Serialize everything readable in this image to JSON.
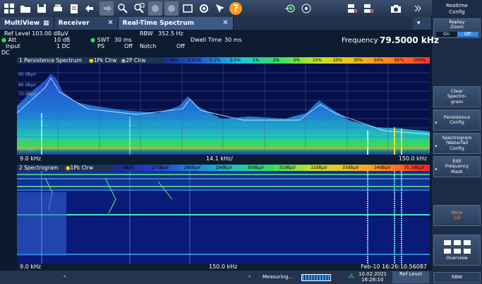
{
  "toolbar": {
    "question_icon": "?"
  },
  "sidebar": {
    "title": "Realtime\nConfig",
    "replay_zoom": "Replay\nZoom",
    "on": "On",
    "off": "Off",
    "clear": "Clear\nSpectro-\ngram",
    "persistence": "Persistence\nConfig",
    "spectrogram": "Spectrogram\n/Waterfall\nConfig",
    "edit_freq": "Edit\nFrequency\nMask",
    "more": "More\n1/2",
    "overview": "Overview",
    "rbw_status": "RBW"
  },
  "tabs": {
    "multiview": "MultiView",
    "receiver": "Receiver",
    "rts": "Real-Time Spectrum"
  },
  "info": {
    "ref_level": "Ref Level 103.00 dBµV",
    "att_label": "Att",
    "att_val": "10 dB",
    "input_label": "Input",
    "input_val": "1 DC",
    "dc": "DC",
    "swt_label": "SWT",
    "swt_val": "30 ms",
    "ps_label": "PS",
    "ps_val": "Off",
    "rbw_label": "RBW",
    "rbw_val": "352.5 Hz",
    "notch_label": "Notch",
    "notch_val": "Off",
    "dwell_label": "Dwell Time",
    "dwell_val": "30 ms",
    "freq_label": "Frequency",
    "freq_val": "79.5000 kHz"
  },
  "panel1": {
    "title": "1 Persistence Spectrum",
    "trace1": "1Pk Clrw",
    "trace2": "2P Clrw",
    "scale": [
      "0%",
      "0.01%",
      "0.1%",
      "0.5%",
      "1%",
      "2%",
      "5%",
      "10%",
      "20%",
      "30%",
      "50%",
      "65%",
      "100%"
    ],
    "y_labels": [
      "90 dBµV",
      "80 dBµV",
      "70 dBµV",
      "20 dBµV",
      "10 dBµV"
    ],
    "x_start": "9.0 kHz",
    "x_mid": "14.1 kHz/",
    "x_end": "150.0 kHz"
  },
  "panel2": {
    "title": "2 Spectrogram",
    "trace1": "1Pk Clrw",
    "scale": [
      "dBµV",
      "27dBµV",
      "28dBµV",
      "29dBµV",
      "30dBµV",
      "31dBµV",
      "32dBµV",
      "33dBµV",
      "34dBµV",
      "35.2dBµV"
    ],
    "x_start": "9.0 kHz",
    "x_mid": "150.0 kHz",
    "timestamp": "Feb-10 16:26:10.56087"
  },
  "status": {
    "measuring": "Measuring...",
    "date": "10.02.2021",
    "time": "16:26:10",
    "ref_level": "Ref Level"
  }
}
